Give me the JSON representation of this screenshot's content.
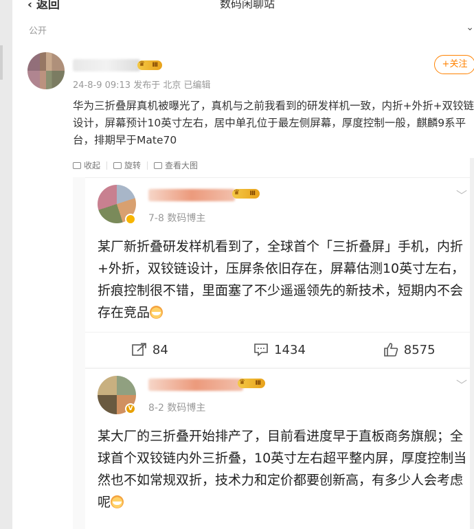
{
  "header": {
    "back_label": "返回",
    "title": "数码闲聊站"
  },
  "visibility_label": "公开",
  "post": {
    "level_label": "Ⅲ",
    "meta": "24-8-9 09:13 发布于 北京  已编辑",
    "follow_label": "+关注",
    "text": "华为三折叠屏真机被曝光了，真机与之前我看到的研发样机一致，内折+外折+双铰链设计，屏幕预计10英寸左右，居中单孔位于最左侧屏幕，厚度控制一般，麒麟9系平台，排期早于Mate70",
    "actions": [
      {
        "icon": "collect-icon",
        "label": "收起"
      },
      {
        "icon": "rotate-icon",
        "label": "旋转"
      },
      {
        "icon": "view-large-icon",
        "label": "查看大图"
      }
    ]
  },
  "retweets": [
    {
      "level_label": "Ⅲ",
      "meta": "7-8  数码博主",
      "text": "某厂新折叠研发样机看到了，全球首个「三折叠屏」手机，内折+外折，双铰链设计，压屏条依旧存在，屏幕估测10英寸左右，折痕控制很不错，里面塞了不少遥遥领先的新技术，短期内不会存在竞品",
      "stats": {
        "reposts": "84",
        "comments": "1434",
        "likes": "8575"
      }
    },
    {
      "level_label": "Ⅲ",
      "meta": "8-2  数码博主",
      "text": "某大厂的三折叠开始排产了，目前看进度早于直板商务旗舰；全球首个双铰链内外三折叠，10英寸左右超平整内屏，厚度控制当然也不如常规双折，技术力和定价都要创新高，有多少人会考虑呢"
    }
  ],
  "colors": {
    "accent": "#ff8200",
    "badge": "#f4c845"
  }
}
